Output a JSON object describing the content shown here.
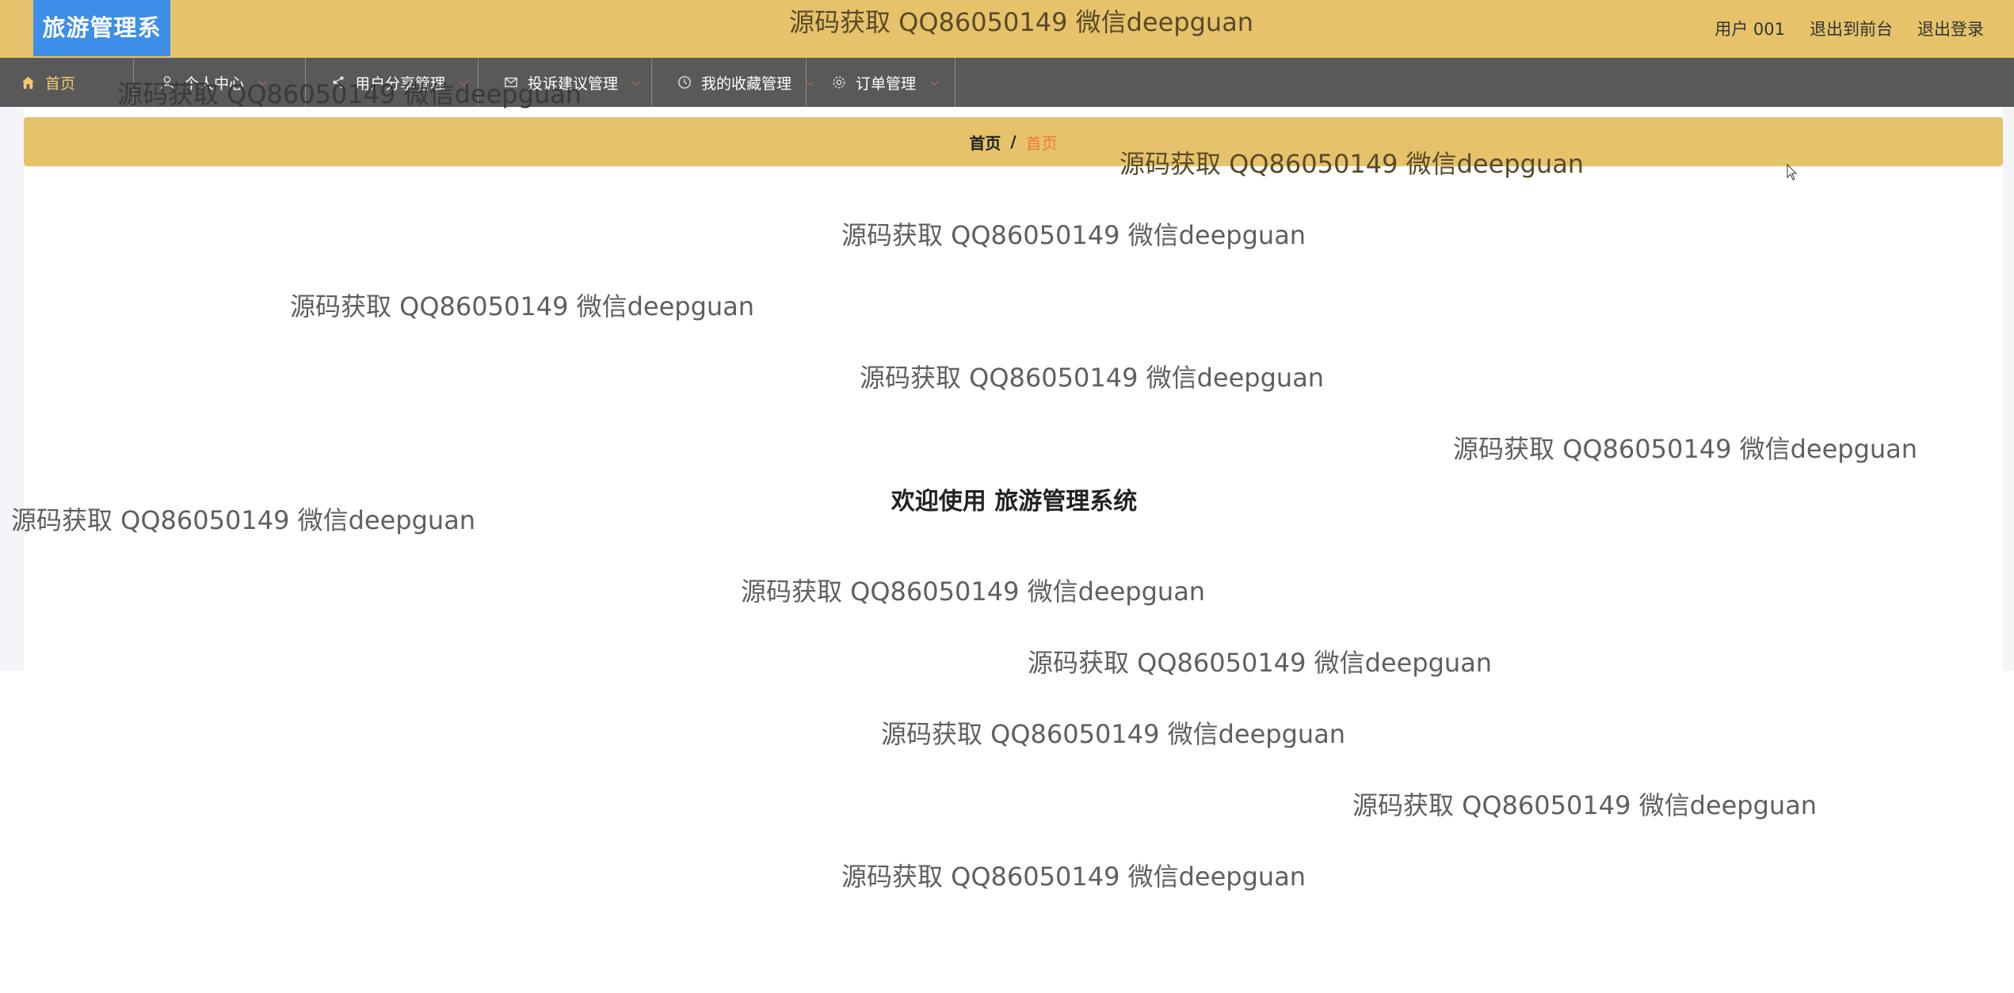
{
  "app": {
    "logo_text": "旅游管理系统"
  },
  "header": {
    "user_label": "用户 001",
    "front_label": "退出到前台",
    "logout_label": "退出登录"
  },
  "nav": {
    "items": [
      {
        "label": "首页",
        "icon": "home-icon"
      },
      {
        "label": "个人中心",
        "icon": "user-icon",
        "has_dropdown": true
      },
      {
        "label": "用户分享管理",
        "icon": "share-icon",
        "has_dropdown": true
      },
      {
        "label": "投诉建议管理",
        "icon": "mail-icon",
        "has_dropdown": true
      },
      {
        "label": "我的收藏管理",
        "icon": "clock-icon",
        "has_dropdown": true
      },
      {
        "label": "订单管理",
        "icon": "gear-icon",
        "has_dropdown": true
      }
    ]
  },
  "breadcrumb": {
    "root": "首页",
    "separator": "/",
    "current": "首页"
  },
  "main": {
    "welcome_text": "欢迎使用 旅游管理系统"
  },
  "watermark": {
    "text": "源码获取 QQ86050149 微信deepguan"
  },
  "colors": {
    "header_bg": "#e6c36a",
    "logo_bg": "#3d8ee8",
    "nav_bg": "#595959",
    "nav_active": "#f3c96c",
    "breadcrumb_current": "#f07a3a",
    "chevron": "#e9766b"
  }
}
